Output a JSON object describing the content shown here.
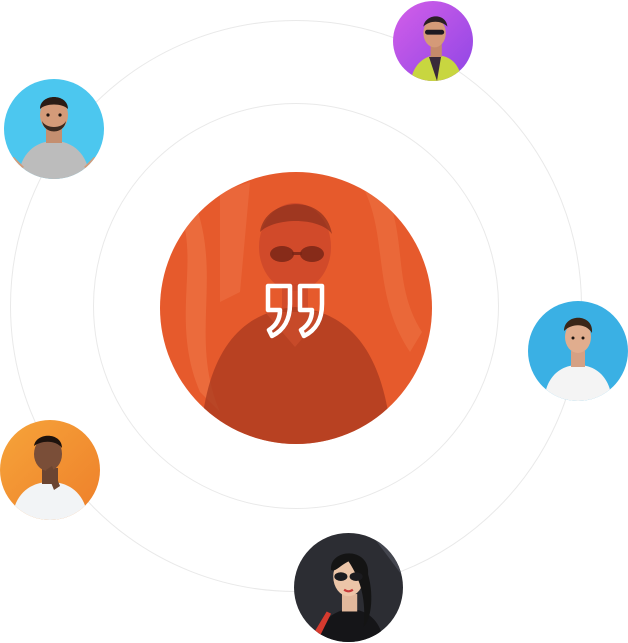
{
  "icons": {
    "center_quote": "quote-icon"
  },
  "colors": {
    "accent": "#e65a2c",
    "ring": "#e9e9e9",
    "avatar_purple": "#b44ee0",
    "avatar_cyan": "#3ec1ec",
    "avatar_blue": "#3aa6dd",
    "avatar_orange": "#f3952f",
    "avatar_dark": "#2a2a2e"
  }
}
